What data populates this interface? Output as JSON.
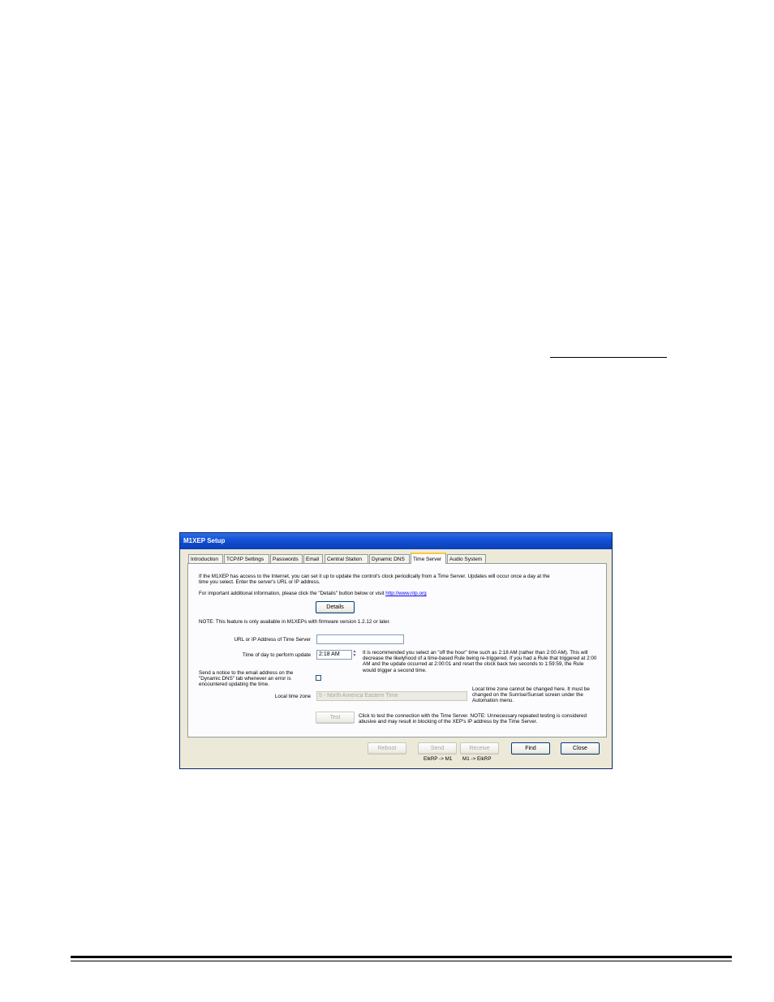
{
  "window": {
    "title": "M1XEP Setup"
  },
  "tabs": [
    {
      "label": "Introduction"
    },
    {
      "label": "TCP/IP Settings"
    },
    {
      "label": "Passwords"
    },
    {
      "label": "Email"
    },
    {
      "label": "Central Station"
    },
    {
      "label": "Dynamic DNS"
    },
    {
      "label": "Time Server",
      "active": true
    },
    {
      "label": "Audio System"
    }
  ],
  "panel": {
    "intro_line1": "If the M1XEP has access to the Internet, you can set it up to update the control's clock periodically from a Time Server.  Updates will occur once a day at the",
    "intro_line2": "time you select.  Enter the server's URL or IP address.",
    "info_text": "For important additional information, please click the \"Details\" button below or visit",
    "info_link": "http://www.ntp.org",
    "details_button": "Details",
    "note": "NOTE: This feature is only available in M1XEPs with firmware version 1.2.12 or later.",
    "url_label": "URL or IP Address of Time Server",
    "url_value": "",
    "time_label": "Time of day to perform update",
    "time_value": "2:18 AM",
    "time_help": "It is recommended you select an \"off the hour\" time such as 2:18 AM (rather than 2:00 AM). This will decrease the likelyhood of a time-based Rule being re-triggered.  If you had a Rule that triggered at 2:00 AM and the update occurred at 2:00:01 and reset the clock back two seconds to 1:59:59, the Rule would trigger a second time.",
    "notice_label": "Send a notice to the email address on the \"Dynamic DNS\" tab whenever an error is encountered updating the time.",
    "notice_checked": false,
    "tz_label": "Local time zone",
    "tz_value": "5 - North America Eastern Time",
    "tz_help": "Local time zone cannot be changed here.  It must be changed on the Sunrise/Sunset screen under the Automation menu.",
    "test_button": "Test",
    "test_help": "Click to test the connection with the Time Server.  NOTE: Unnecessary repeated testing is considered abusive and may result in blocking of the XEP's IP address by the Time Server."
  },
  "footer": {
    "reboot_button": "Reboot",
    "send_button": "Send",
    "send_caption": "ElkRP -> M1",
    "receive_button": "Receive",
    "receive_caption": "M1 -> ElkRP",
    "find_button": "Find",
    "close_button": "Close"
  }
}
